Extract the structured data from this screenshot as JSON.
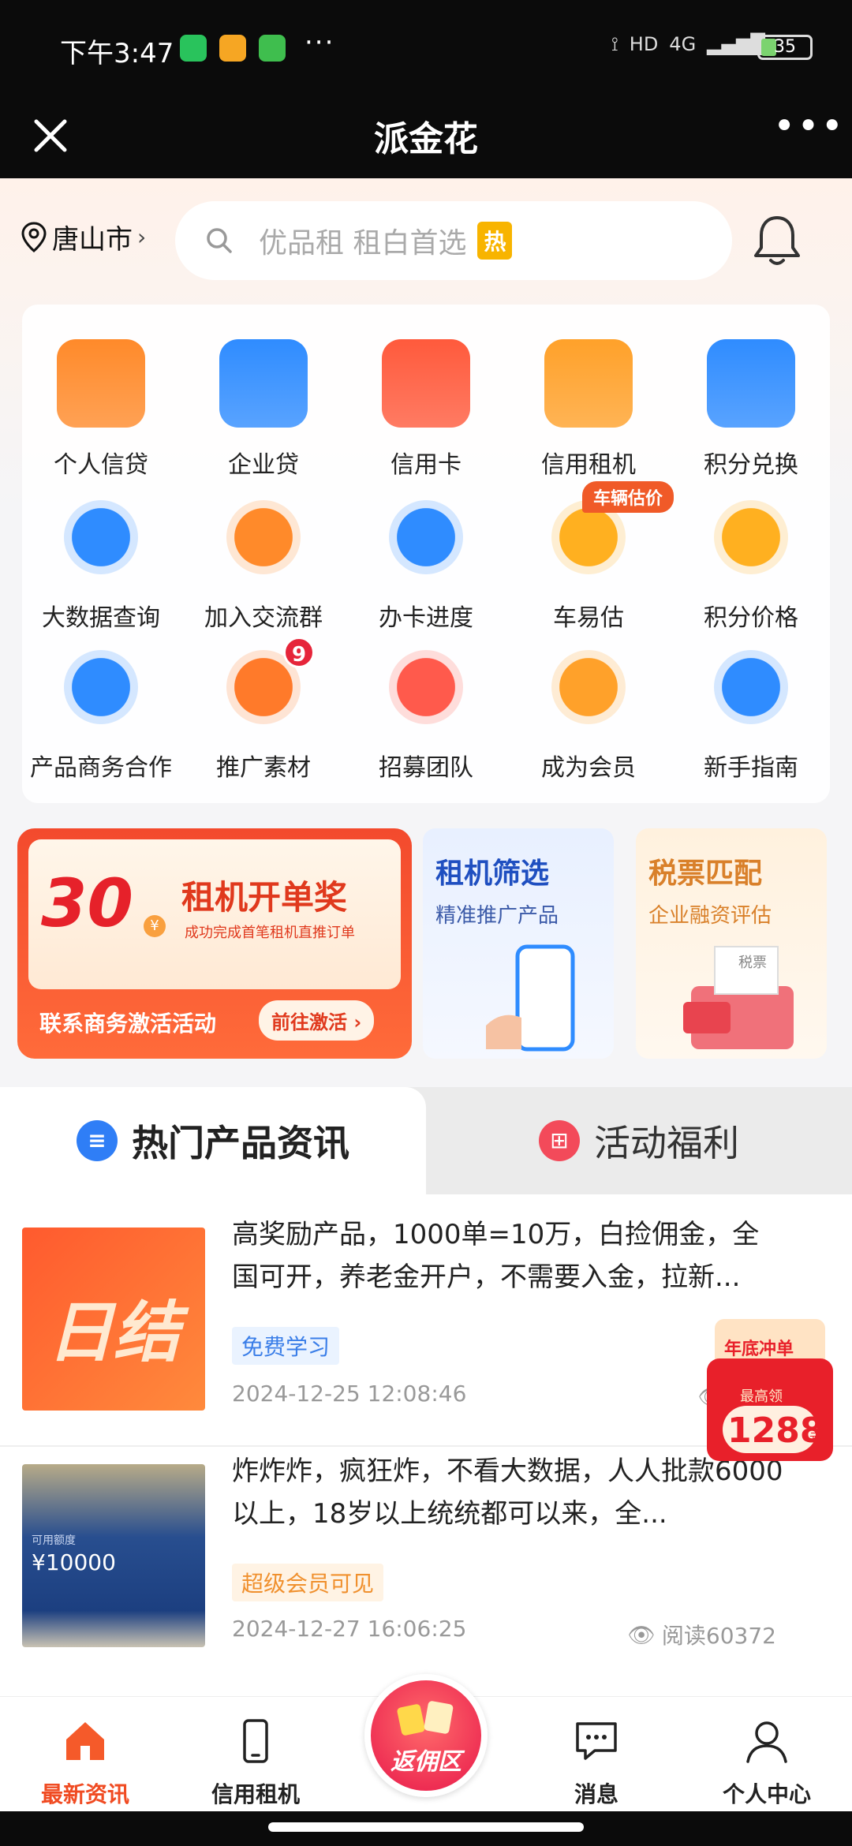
{
  "status_bar": {
    "time": "下午3:47",
    "battery": "35",
    "network": "4G",
    "hd": "HD"
  },
  "titlebar": {
    "title": "派金花"
  },
  "header": {
    "city": "唐山市",
    "search_placeholder": "优品租 租白首选",
    "search_badge": "热"
  },
  "grid": [
    {
      "label": "个人信贷",
      "icon": "personal-loan-icon",
      "color": "#ff8a2a"
    },
    {
      "label": "企业贷",
      "icon": "building-icon",
      "color": "#2f8cff"
    },
    {
      "label": "信用卡",
      "icon": "credit-card-icon",
      "color": "#ff5a3c"
    },
    {
      "label": "信用租机",
      "icon": "phone-rent-icon",
      "color": "#ffa12a"
    },
    {
      "label": "积分兑换",
      "icon": "points-exchange-icon",
      "color": "#2f8cff"
    },
    {
      "label": "大数据查询",
      "icon": "bigdata-search-icon",
      "color": "#2f8cff"
    },
    {
      "label": "加入交流群",
      "icon": "chat-group-icon",
      "color": "#ff8a2a"
    },
    {
      "label": "办卡进度",
      "icon": "card-progress-icon",
      "color": "#2f8cff"
    },
    {
      "label": "车易估",
      "icon": "car-icon",
      "color": "#ffb020"
    },
    {
      "label": "积分价格",
      "icon": "star-price-icon",
      "color": "#ffb020"
    },
    {
      "label": "产品商务合作",
      "icon": "business-coop-icon",
      "color": "#2f8cff"
    },
    {
      "label": "推广素材",
      "icon": "aperture-icon",
      "color": "#ff7a2a"
    },
    {
      "label": "招募团队",
      "icon": "recruit-team-icon",
      "color": "#ff5a4c"
    },
    {
      "label": "成为会员",
      "icon": "diamond-icon",
      "color": "#ffa12a"
    },
    {
      "label": "新手指南",
      "icon": "help-guide-icon",
      "color": "#2f8cff"
    }
  ],
  "grid_badges": {
    "car_tag": "车辆估价",
    "material_count": "9"
  },
  "promo": {
    "amount": "30",
    "currency": "¥",
    "title": "租机开单奖",
    "subtitle": "成功完成首笔租机直推订单",
    "cta_text": "联系商务激活活动",
    "cta_button": "前往激活"
  },
  "mini_cards": [
    {
      "title": "租机筛选",
      "subtitle": "精准推广产品"
    },
    {
      "title": "税票匹配",
      "subtitle": "企业融资评估",
      "label": "税票"
    }
  ],
  "tabs": [
    {
      "label": "热门产品资讯",
      "active": true
    },
    {
      "label": "活动福利",
      "active": false
    }
  ],
  "articles": [
    {
      "thumb_text": "日结",
      "title": "高奖励产品，1000单=10万，白捡佣金，全国可开，养老金开户，不需要入金，拉新...",
      "tag": "免费学习",
      "date": "2024-12-25 12:08:46",
      "reads": "阅读"
    },
    {
      "thumb_text": "¥10000",
      "thumb_small": "可用额度",
      "title": "炸炸炸，疯狂炸，不看大数据，人人批款6000以上，18岁以上统统都可以来，全...",
      "tag": "超级会员可见",
      "date": "2024-12-27 16:06:25",
      "reads": "阅读60372"
    }
  ],
  "float_badge": {
    "top": "年底冲单",
    "label": "最高领",
    "amount": "1288",
    "unit": "元"
  },
  "bottom_nav": [
    {
      "label": "最新资讯",
      "icon": "home-icon",
      "active": true
    },
    {
      "label": "信用租机",
      "icon": "phone-icon",
      "active": false
    },
    {
      "label": "返佣区",
      "icon": "rebate-icon",
      "active": false
    },
    {
      "label": "消息",
      "icon": "message-icon",
      "active": false
    },
    {
      "label": "个人中心",
      "icon": "profile-icon",
      "active": false
    }
  ]
}
